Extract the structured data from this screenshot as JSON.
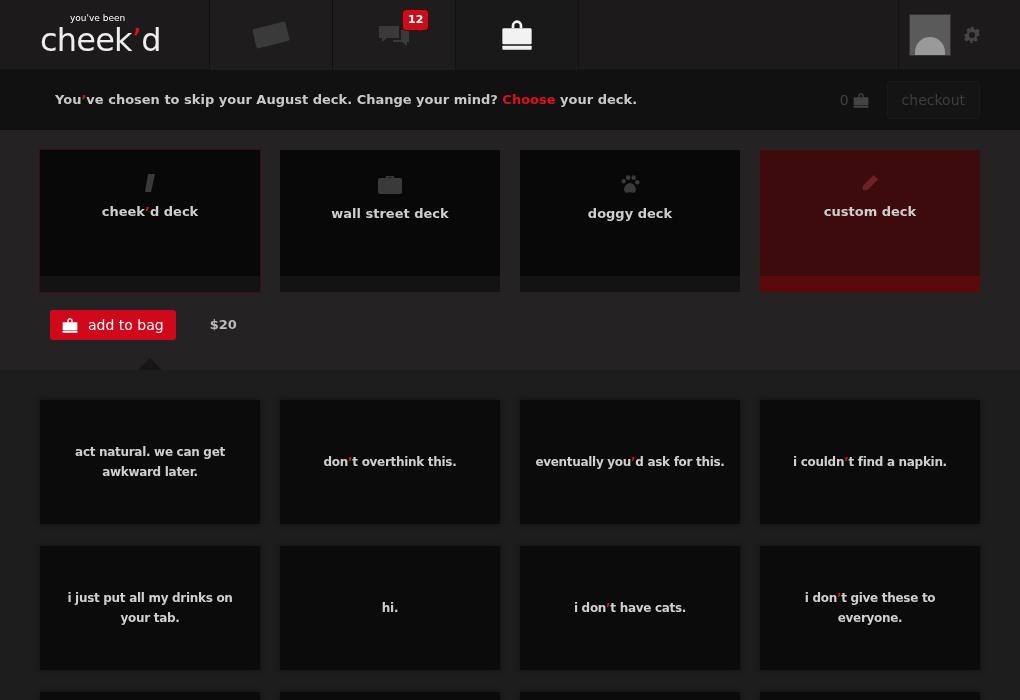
{
  "logo": {
    "tagline": "you've been",
    "parts": [
      {
        "text": "cheek"
      },
      {
        "text": "’",
        "accent": true
      },
      {
        "text": "d"
      }
    ]
  },
  "nav_tabs": [
    {
      "selected": false
    },
    {
      "selected": false,
      "badge": "12"
    },
    {
      "selected": true
    }
  ],
  "banner": {
    "parts": [
      {
        "text": "You"
      },
      {
        "text": "’",
        "accent": true
      },
      {
        "text": "ve chosen to skip your August deck. Change your mind? "
      }
    ],
    "link": "Choose",
    "after": " your deck."
  },
  "cart": {
    "count": "0",
    "checkout": "checkout",
    "checkout_disabled": true
  },
  "decks": [
    {
      "kind": "preset",
      "selected": true,
      "parts": [
        {
          "text": "cheek"
        },
        {
          "text": "’",
          "accent": true
        },
        {
          "text": "d deck"
        }
      ]
    },
    {
      "kind": "preset",
      "selected": false,
      "parts": [
        {
          "text": "wall street deck"
        }
      ]
    },
    {
      "kind": "preset",
      "selected": false,
      "parts": [
        {
          "text": "doggy deck"
        }
      ]
    },
    {
      "kind": "custom",
      "selected": false,
      "parts": [
        {
          "text": "custom deck"
        }
      ]
    }
  ],
  "purchase": {
    "button": "add to bag",
    "price": "$20"
  },
  "cards": [
    {
      "kind": "text",
      "parts": [
        {
          "text": "act natural. we can get awkward later."
        }
      ]
    },
    {
      "kind": "text",
      "parts": [
        {
          "text": "don"
        },
        {
          "text": "’",
          "accent": true
        },
        {
          "text": "t overthink this."
        }
      ]
    },
    {
      "kind": "text",
      "parts": [
        {
          "text": "eventually you"
        },
        {
          "text": "’",
          "accent": true
        },
        {
          "text": "d ask for this."
        }
      ]
    },
    {
      "kind": "text",
      "parts": [
        {
          "text": "i couldn"
        },
        {
          "text": "’",
          "accent": true
        },
        {
          "text": "t find a napkin."
        }
      ]
    },
    {
      "kind": "text",
      "parts": [
        {
          "text": "i just put all my drinks on your tab."
        }
      ]
    },
    {
      "kind": "text",
      "parts": [
        {
          "text": "hi."
        }
      ]
    },
    {
      "kind": "text",
      "parts": [
        {
          "text": "i don"
        },
        {
          "text": "’",
          "accent": true
        },
        {
          "text": "t have cats."
        }
      ]
    },
    {
      "kind": "text",
      "parts": [
        {
          "text": "i don"
        },
        {
          "text": "’",
          "accent": true
        },
        {
          "text": "t give these to everyone."
        }
      ]
    },
    {
      "kind": "blank"
    },
    {
      "kind": "blank"
    },
    {
      "kind": "blank"
    },
    {
      "kind": "blank"
    }
  ]
}
